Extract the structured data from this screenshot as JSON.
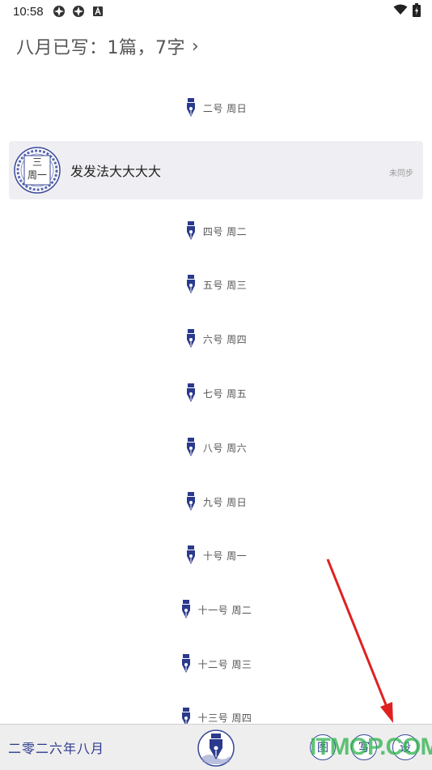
{
  "status_bar": {
    "time": "10:58",
    "icons": [
      "sync-icon",
      "sync-icon",
      "a-icon",
      "wifi-icon",
      "battery-charging-icon"
    ]
  },
  "header": {
    "summary": "八月已写：1篇，7字",
    "chevron": "›"
  },
  "days": [
    {
      "label": "二号 周日"
    },
    {
      "label": "四号 周二"
    },
    {
      "label": "五号 周三"
    },
    {
      "label": "六号 周四"
    },
    {
      "label": "七号 周五"
    },
    {
      "label": "八号 周六"
    },
    {
      "label": "九号 周日"
    },
    {
      "label": "十号 周一"
    },
    {
      "label": "十一号 周二"
    },
    {
      "label": "十二号 周三"
    },
    {
      "label": "十三号 周四"
    }
  ],
  "entry": {
    "seal_day": "三",
    "seal_weekday": "周一",
    "title": "发发法大大大大",
    "sync_status": "未同步"
  },
  "bottom_bar": {
    "year_month": "二零二六年八月",
    "buttons": [
      "图",
      "写",
      "设"
    ]
  },
  "watermark": "ITMOP.COM",
  "colors": {
    "accent": "#2b3a8c",
    "annotation_arrow": "#e02020",
    "watermark": "#2bb34a"
  }
}
